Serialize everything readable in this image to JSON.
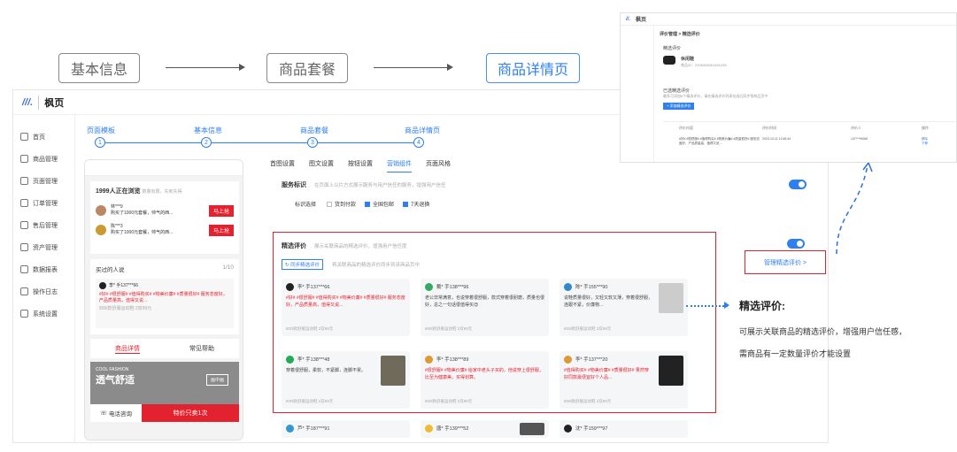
{
  "flow": {
    "step1": "基本信息",
    "step2": "商品套餐",
    "step3": "商品详情页"
  },
  "app": {
    "brand": "枫页"
  },
  "sidebar": {
    "items": [
      "首页",
      "商品管理",
      "页面管理",
      "订单管理",
      "售后管理",
      "资产管理",
      "数据报表",
      "操作日志",
      "系统设置"
    ]
  },
  "steps": [
    {
      "label": "页面模板",
      "num": "1"
    },
    {
      "label": "基本信息",
      "num": "2"
    },
    {
      "label": "商品套餐",
      "num": "3"
    },
    {
      "label": "商品详情页",
      "num": "4"
    }
  ],
  "phone": {
    "viewing": "1999人正在浏览",
    "viewing_sub": "数量有限，先到先得",
    "buyers": [
      {
        "name": "林***9",
        "desc": "购买了1000元套餐，帅气的西...",
        "btn": "马上抢"
      },
      {
        "name": "陈***3",
        "desc": "购买了1000元套餐，帅气的西...",
        "btn": "马上抢"
      }
    ],
    "bought": "买过的人说",
    "bought_count": "1/10",
    "review_name": "李* 手137***66",
    "review_tags": "#好# #很舒服# #值得购买# #物美价廉# #质量很好# 服务态度好，产品质量高，值得又说...",
    "review_meta": "800l款舒服运动鞋 2双99元",
    "tab_detail": "商品详情",
    "tab_help": "常见帮助",
    "banner_top": "COOL FASHION",
    "banner_text": "透气舒适",
    "banner_badge": "画中画",
    "call": "电话咨询",
    "buy": "特价只卖1次"
  },
  "tabs": [
    "首图设置",
    "图文设置",
    "按钮设置",
    "营销组件",
    "页面风格"
  ],
  "service": {
    "label": "服务标识",
    "hint": "在页面上以片方式展示服务与用户信任的服务，增强用户信任",
    "select_label": "标识选择",
    "opt1": "货到付款",
    "opt2": "全国包邮",
    "opt3": "7天退换"
  },
  "reviews": {
    "label": "精选评价",
    "hint": "展示关联商品的精选评价，增强用户信任度",
    "sync": "同步精选评价",
    "sync_hint": "将关联商品的精选评价同步到该商品页中",
    "manage": "管理精选评价 >",
    "cards": [
      {
        "name": "李* 手137***66",
        "text": "#好# #很舒服# #值得购买# #物美价廉# #质量很好# 服务态度好，产品质量高，值得又说...",
        "meta": "800l款舒服运动鞋 2双99元"
      },
      {
        "name": "戴* 手138***96",
        "text": "老公非常满意，也说穿着很舒服，款式穿着很耐磨，质量也很好，总之一句话很值得买😍",
        "meta": "800l款舒服运动鞋 2双99元"
      },
      {
        "name": "陈* 手155***90",
        "text": "说鞋质量很好，又轻又软又薄，穿着很舒服，连跟不紧，价廉物...",
        "meta": "800l款舒服运动鞋 2双99元"
      },
      {
        "name": "李* 手138***48",
        "text": "穿着很舒服，柔软，不紧脚，连脚不累。",
        "meta": "800l款舒服运动鞋 2双99元"
      },
      {
        "name": "李* 手138***89",
        "text": "#很舒服# #物美价廉# 给家中老头子买的，他说穿上很舒服，比至为健康美，买得划算。",
        "meta": "800l款舒服运动鞋 2双99元"
      },
      {
        "name": "李* 手137***20",
        "text": "#值得购买# #物美价廉# #质量很好# 果然穿好同款最便宜好个人品...",
        "meta": "800l款舒服运动鞋 2双99元"
      },
      {
        "name": "芦* 手187***91",
        "text": "",
        "meta": ""
      },
      {
        "name": "唐* 手139***52",
        "text": "",
        "meta": ""
      },
      {
        "name": "沈* 手159***97",
        "text": "",
        "meta": ""
      }
    ]
  },
  "annotation": {
    "title": "精选评价:",
    "line1": "可展示关联商品的精选评价，增强用户信任感，",
    "line2": "需商品有一定数量评价才能设置"
  },
  "mini": {
    "brand": "枫页",
    "crumb": "评价管理 > 精选评价",
    "section": "精选评价",
    "product": "休闲鞋",
    "product_id": "商品ID：2205408261491235",
    "list_title": "已选精选评价",
    "list_hint": "最多可添加6个精选评价，请在精选评价列表勾选后同步到商品页中",
    "add_btn": "+ 添加精选评价",
    "col1": "评价内容",
    "col2": "评价时间",
    "col3": "评价人",
    "col4": "操作",
    "row_text": "#好# #很舒服# #值得购买# #物美价廉# #质量很好# 服务态度好，产品质量高，值得又说...",
    "row_time": "2023-10-11 12:45:44",
    "row_user": "137****6066",
    "op1": "移除",
    "op2": "下移"
  }
}
